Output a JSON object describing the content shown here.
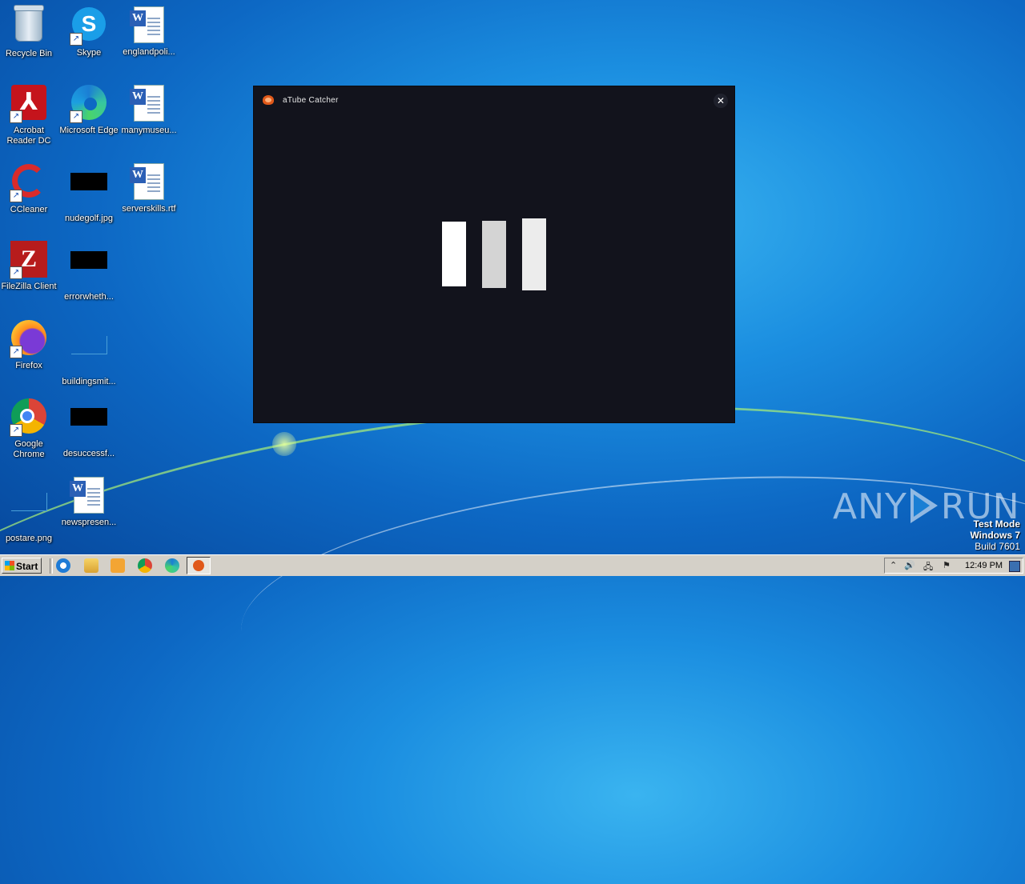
{
  "desktop": {
    "icons": [
      {
        "label": "Recycle Bin"
      },
      {
        "label": "Skype"
      },
      {
        "label": "englandpoli..."
      },
      {
        "label": "Acrobat Reader DC"
      },
      {
        "label": "Microsoft Edge"
      },
      {
        "label": "manymuseu..."
      },
      {
        "label": "CCleaner"
      },
      {
        "label": "nudegolf.jpg"
      },
      {
        "label": "serverskills.rtf"
      },
      {
        "label": "FileZilla Client"
      },
      {
        "label": "errorwheth..."
      },
      {
        "label": "Firefox"
      },
      {
        "label": "buildingsmit..."
      },
      {
        "label": "Google Chrome"
      },
      {
        "label": "desuccessf..."
      },
      {
        "label": "postare.png"
      },
      {
        "label": "newspresen..."
      }
    ],
    "glyphs": {
      "skype": "S",
      "word": "W",
      "acrobat": "⅄",
      "filezilla": "Z",
      "shortcut": "↗"
    }
  },
  "window": {
    "title": "aTube Catcher",
    "close_glyph": "✕"
  },
  "watermark": {
    "brand_left": "ANY",
    "brand_right": "RUN",
    "test_mode": "Test Mode",
    "os": "Windows 7",
    "build": "Build 7601"
  },
  "taskbar": {
    "start_label": "Start",
    "clock": "12:49 PM",
    "tray_glyphs": {
      "arrow": "⌃",
      "volume": "🔊",
      "network": "🖧",
      "flag": "⚑"
    }
  }
}
